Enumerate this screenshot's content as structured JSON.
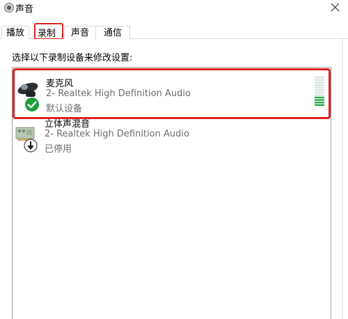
{
  "window": {
    "title": "声音"
  },
  "tabs": [
    {
      "label": "播放"
    },
    {
      "label": "录制"
    },
    {
      "label": "声音"
    },
    {
      "label": "通信"
    }
  ],
  "instruction": "选择以下录制设备来修改设置:",
  "devices": [
    {
      "name": "麦克风",
      "driver": "2- Realtek High Definition Audio",
      "status": "默认设备",
      "icon": "microphone-icon",
      "badge": "check-badge-icon",
      "level_bars_total": 12,
      "level_bars_active": 4
    },
    {
      "name": "立体声混音",
      "driver": "2- Realtek High Definition Audio",
      "status": "已停用",
      "icon": "sound-card-icon",
      "badge": "disabled-arrow-badge-icon"
    }
  ],
  "colors": {
    "highlight_red": "#e02020",
    "check_green": "#1e9e3a",
    "meter_green": "#2da84a",
    "meter_inactive": "#d6e6d9"
  }
}
